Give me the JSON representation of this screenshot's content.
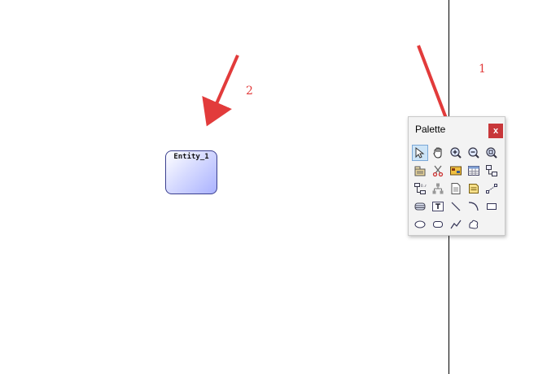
{
  "annotations": {
    "label_1": "1",
    "label_2": "2",
    "color": "#e23b3b"
  },
  "entity": {
    "label": "Entity_1"
  },
  "palette": {
    "title": "Palette",
    "close_label": "x",
    "tools": [
      {
        "icon": "pointer-icon",
        "selected": true
      },
      {
        "icon": "hand-grabber-icon"
      },
      {
        "icon": "zoom-in-icon"
      },
      {
        "icon": "zoom-out-icon"
      },
      {
        "icon": "zoom-fit-icon"
      },
      {
        "icon": "package-icon"
      },
      {
        "icon": "delete-scissors-icon"
      },
      {
        "icon": "entity-icon"
      },
      {
        "icon": "table-icon"
      },
      {
        "icon": "relationship-icon"
      },
      {
        "icon": "inheritance-icon"
      },
      {
        "icon": "hierarchy-icon"
      },
      {
        "icon": "file-icon"
      },
      {
        "icon": "note-icon"
      },
      {
        "icon": "link-icon"
      },
      {
        "icon": "database-icon"
      },
      {
        "icon": "text-icon"
      },
      {
        "icon": "line-icon"
      },
      {
        "icon": "arc-icon"
      },
      {
        "icon": "rectangle-icon"
      },
      {
        "icon": "ellipse-icon"
      },
      {
        "icon": "rounded-rectangle-icon"
      },
      {
        "icon": "polyline-icon"
      },
      {
        "icon": "freeform-icon"
      }
    ]
  }
}
